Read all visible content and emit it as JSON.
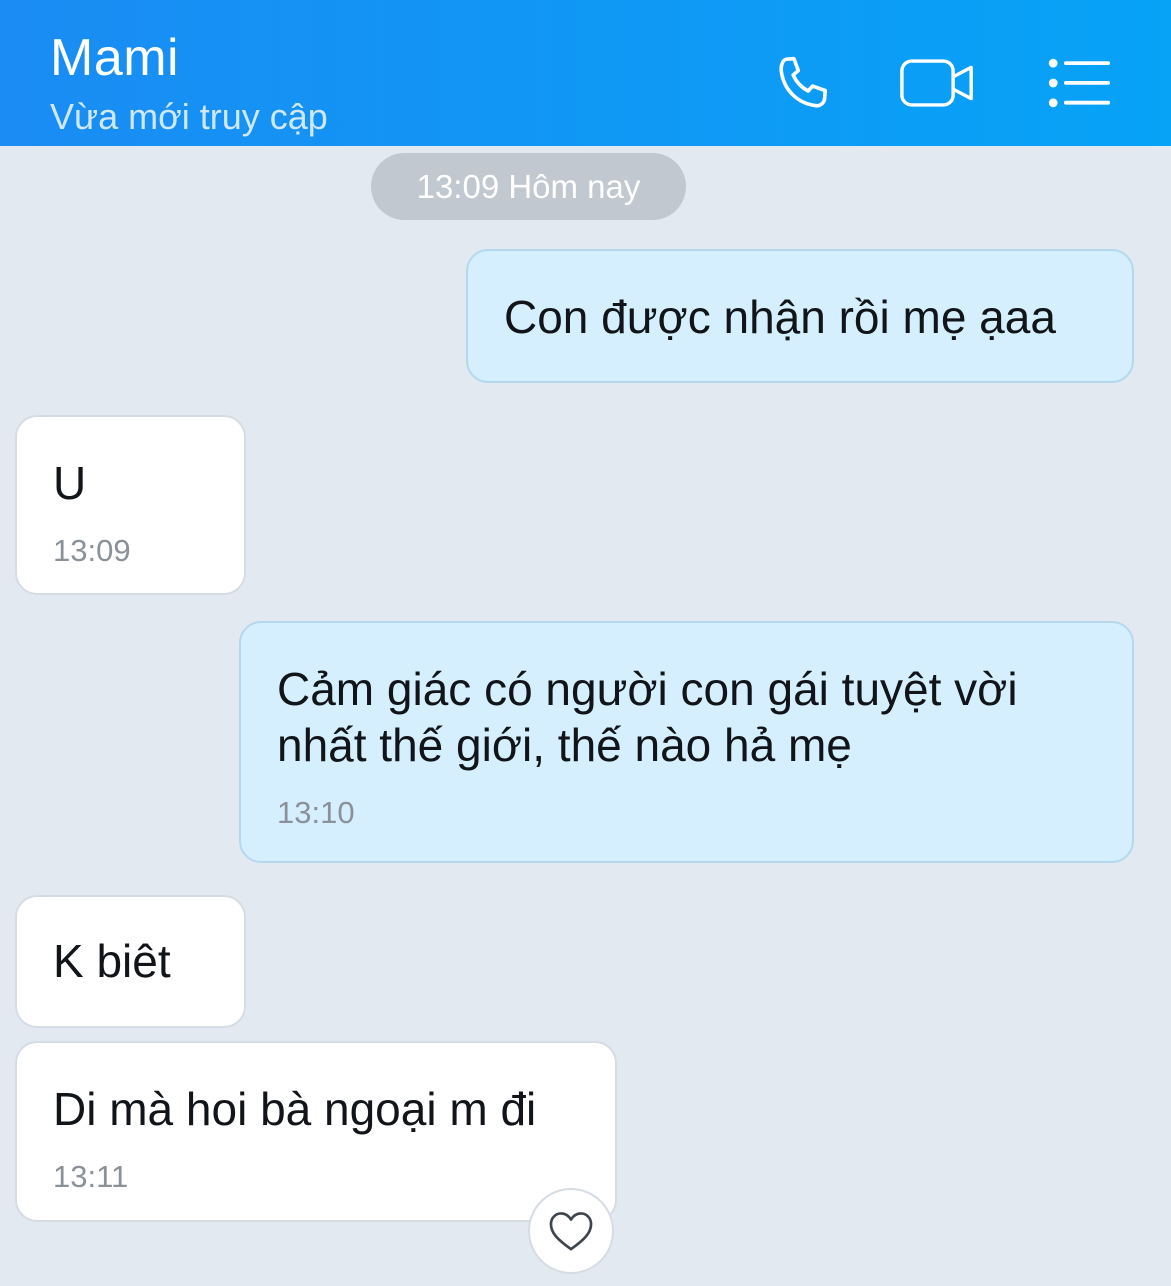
{
  "header": {
    "name": "Mami",
    "status": "Vừa mới truy cập"
  },
  "date_separator": "13:09 Hôm nay",
  "messages": [
    {
      "direction": "outgoing",
      "text": "Con được nhận rồi mẹ ạaa",
      "time": ""
    },
    {
      "direction": "incoming",
      "text": "U",
      "time": "13:09"
    },
    {
      "direction": "outgoing",
      "text": "Cảm giác có người con gái tuyệt vời\nnhất thế giới, thế nào hả mẹ",
      "time": "13:10"
    },
    {
      "direction": "incoming",
      "text": "K biêt",
      "time": ""
    },
    {
      "direction": "incoming",
      "text": "Di mà hoi bà ngoại m đi",
      "time": "13:11"
    }
  ],
  "icons": {
    "call": "phone-icon",
    "video": "video-camera-icon",
    "menu": "list-menu-icon",
    "reaction": "heart-icon"
  },
  "colors": {
    "header_start": "#1a8cf3",
    "header_end": "#06a3f7",
    "background": "#e2e9f1",
    "outgoing_bubble": "#d5efff",
    "incoming_bubble": "#ffffff"
  }
}
